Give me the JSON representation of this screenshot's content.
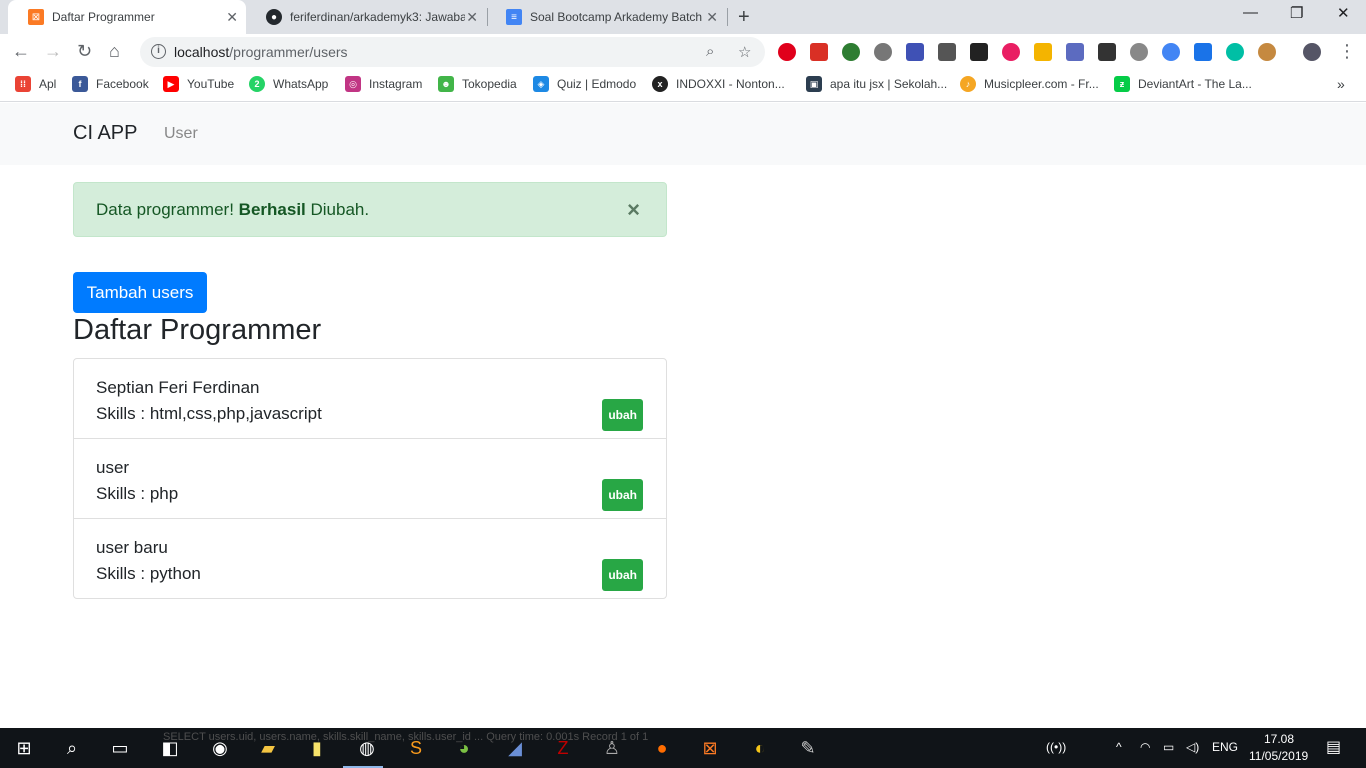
{
  "browser": {
    "tabs": [
      {
        "title": "Daftar Programmer",
        "icon": "xampp-icon",
        "color": "#fb7a24"
      },
      {
        "title": "feriferdinan/arkademyk3: Jawaba",
        "icon": "github-icon",
        "color": "#24292e"
      },
      {
        "title": "Soal Bootcamp Arkademy Batch",
        "icon": "docs-icon",
        "color": "#4285f4"
      }
    ],
    "new_tab": "+",
    "window_controls": {
      "minimize": "—",
      "restore": "❐",
      "close": "✕"
    },
    "url_host": "localhost",
    "url_path": "/programmer/users",
    "bookmarks": [
      {
        "label": "Apl",
        "icon": "apps-icon",
        "color": "#ea4335"
      },
      {
        "label": "Facebook",
        "icon": "facebook-icon",
        "color": "#3b5998"
      },
      {
        "label": "YouTube",
        "icon": "youtube-icon",
        "color": "#ff0000"
      },
      {
        "label": "WhatsApp",
        "icon": "whatsapp-icon",
        "color": "#25d366"
      },
      {
        "label": "Instagram",
        "icon": "instagram-icon",
        "color": "#c13584"
      },
      {
        "label": "Tokopedia",
        "icon": "tokopedia-icon",
        "color": "#42b549"
      },
      {
        "label": "Quiz | Edmodo",
        "icon": "edmodo-icon",
        "color": "#1d89e4"
      },
      {
        "label": "INDOXXI - Nonton...",
        "icon": "indoxxi-icon",
        "color": "#222222"
      },
      {
        "label": "apa itu jsx | Sekolah...",
        "icon": "sekolah-icon",
        "color": "#2c3e50"
      },
      {
        "label": "Musicpleer.com - Fr...",
        "icon": "musicpleer-icon",
        "color": "#f5a623"
      },
      {
        "label": "DeviantArt - The La...",
        "icon": "deviantart-icon",
        "color": "#05cc47"
      }
    ]
  },
  "navbar": {
    "brand": "CI APP",
    "link": "User"
  },
  "alert": {
    "prefix": "Data programmer! ",
    "bold": "Berhasil",
    "suffix": " Diubah.",
    "close": "×"
  },
  "add_button": "Tambah users",
  "heading": "Daftar Programmer",
  "programmers": [
    {
      "name": "Septian Feri Ferdinan",
      "skills": "Skills : html,css,php,javascript",
      "action": "ubah"
    },
    {
      "name": "user",
      "skills": "Skills : php",
      "action": "ubah"
    },
    {
      "name": "user baru",
      "skills": "Skills : python",
      "action": "ubah"
    }
  ],
  "taskbar": {
    "ghost_text": "SELECT users.uid, users.name, skills.skill_name, skills.user_id ... Query time: 0.001s   Record 1 of 1",
    "lang": "ENG",
    "time": "17.08",
    "date": "11/05/2019"
  }
}
